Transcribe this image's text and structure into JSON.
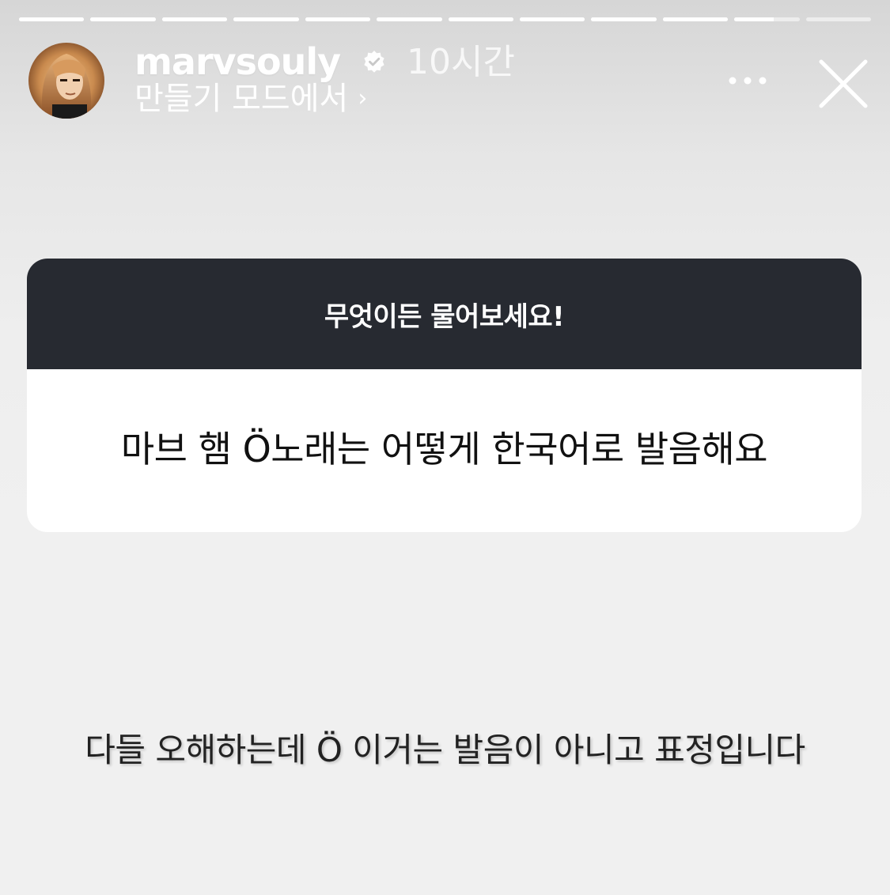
{
  "story": {
    "segments": [
      {
        "progress": 1.0
      },
      {
        "progress": 1.0
      },
      {
        "progress": 1.0
      },
      {
        "progress": 1.0
      },
      {
        "progress": 1.0
      },
      {
        "progress": 1.0
      },
      {
        "progress": 1.0
      },
      {
        "progress": 1.0
      },
      {
        "progress": 1.0
      },
      {
        "progress": 1.0
      },
      {
        "progress": 0.6
      },
      {
        "progress": 0.0
      }
    ]
  },
  "header": {
    "username": "marvsouly",
    "verified_icon": "verified-badge-icon",
    "timestamp": "10시간",
    "subtitle": "만들기 모드에서",
    "subtitle_chevron": "›",
    "more_icon": "more-options-icon",
    "close_icon": "close-icon",
    "avatar_icon": "avatar-photo"
  },
  "question_card": {
    "title": "무엇이든 물어보세요!",
    "question": "마브 햄 Ö노래는 어떻게 한국어로 발음해요"
  },
  "reply_text": "다들 오해하는데 Ö 이거는 발음이 아니고 표정입니다",
  "colors": {
    "card_header": "#272a31",
    "card_body": "#ffffff",
    "background": "#f0f0f0"
  }
}
